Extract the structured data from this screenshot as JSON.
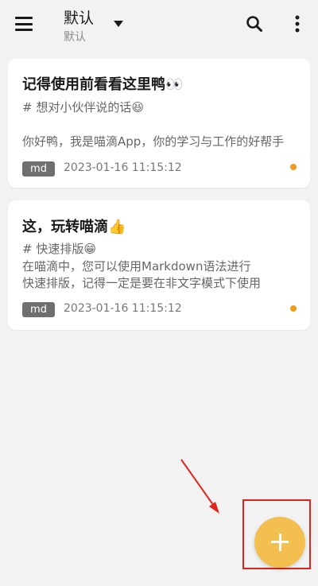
{
  "header": {
    "title": "默认",
    "subtitle": "默认",
    "icons": [
      "menu-icon",
      "dropdown-icon",
      "search-icon",
      "more-vert-icon"
    ]
  },
  "notes": [
    {
      "title": "记得使用前看看这里鸭👀",
      "heading": "# 想对小伙伴说的话😆",
      "preview": "你好鸭，我是喵滴App，你的学习与工作的好帮手",
      "tag": "md",
      "datetime": "2023-01-16 11:15:12"
    },
    {
      "title": "这，玩转喵滴👍",
      "heading": "# 快速排版😁",
      "preview_line1": "在喵滴中，您可以使用Markdown语法进行",
      "preview_line2": "快速排版，记得一定是要在非文字模式下使用",
      "tag": "md",
      "datetime": "2023-01-16 11:15:12"
    }
  ],
  "fab": {
    "icon": "plus-icon"
  },
  "colors": {
    "background": "#f2f2f2",
    "accent": "#f3c04f",
    "status_dot": "#f29b1d",
    "annotation": "#e0241b",
    "tag": "#6f6f6f"
  }
}
